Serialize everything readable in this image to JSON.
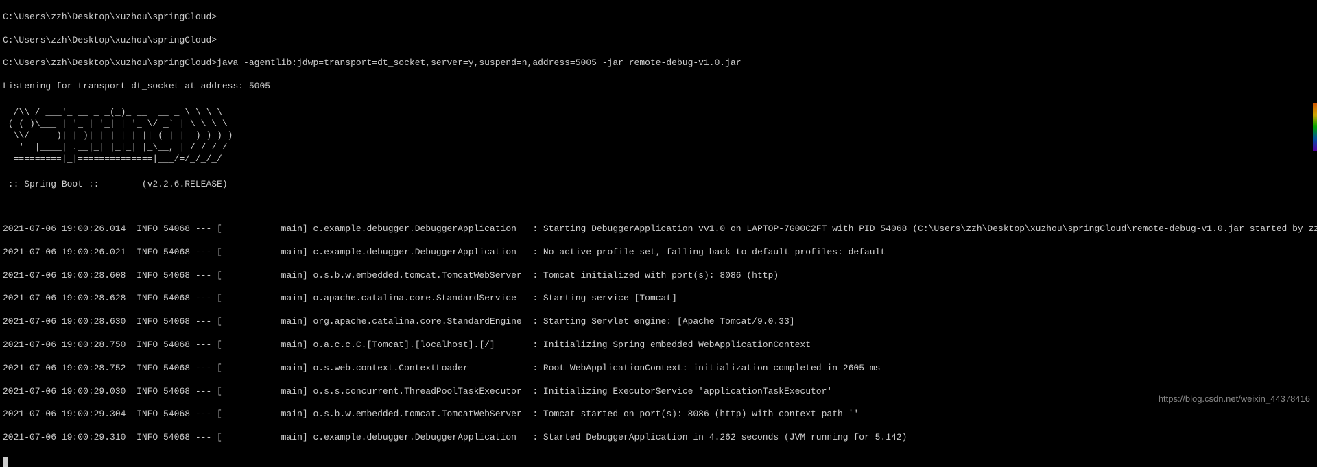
{
  "prompts": [
    "C:\\Users\\zzh\\Desktop\\xuzhou\\springCloud>",
    "C:\\Users\\zzh\\Desktop\\xuzhou\\springCloud>",
    "C:\\Users\\zzh\\Desktop\\xuzhou\\springCloud>java -agentlib:jdwp=transport=dt_socket,server=y,suspend=n,address=5005 -jar remote-debug-v1.0.jar",
    "Listening for transport dt_socket at address: 5005"
  ],
  "banner": "  /\\\\ / ___'_ __ _ _(_)_ __  __ _ \\ \\ \\ \\\n ( ( )\\___ | '_ | '_| | '_ \\/ _` | \\ \\ \\ \\\n  \\\\/  ___)| |_)| | | | | || (_| |  ) ) ) )\n   '  |____| .__|_| |_|_| |_\\__, | / / / /\n  =========|_|==============|___/=/_/_/_/",
  "bootline": " :: Spring Boot ::        (v2.2.6.RELEASE)",
  "logs": [
    "2021-07-06 19:00:26.014  INFO 54068 --- [           main] c.example.debugger.DebuggerApplication   : Starting DebuggerApplication vv1.0 on LAPTOP-7G00C2FT with PID 54068 (C:\\Users\\zzh\\Desktop\\xuzhou\\springCloud\\remote-debug-v1.0.jar started by zzh in C:\\Users\\zzh\\Desktop\\xuzhou\\springCloud)",
    "2021-07-06 19:00:26.021  INFO 54068 --- [           main] c.example.debugger.DebuggerApplication   : No active profile set, falling back to default profiles: default",
    "2021-07-06 19:00:28.608  INFO 54068 --- [           main] o.s.b.w.embedded.tomcat.TomcatWebServer  : Tomcat initialized with port(s): 8086 (http)",
    "2021-07-06 19:00:28.628  INFO 54068 --- [           main] o.apache.catalina.core.StandardService   : Starting service [Tomcat]",
    "2021-07-06 19:00:28.630  INFO 54068 --- [           main] org.apache.catalina.core.StandardEngine  : Starting Servlet engine: [Apache Tomcat/9.0.33]",
    "2021-07-06 19:00:28.750  INFO 54068 --- [           main] o.a.c.c.C.[Tomcat].[localhost].[/]       : Initializing Spring embedded WebApplicationContext",
    "2021-07-06 19:00:28.752  INFO 54068 --- [           main] o.s.web.context.ContextLoader            : Root WebApplicationContext: initialization completed in 2605 ms",
    "2021-07-06 19:00:29.030  INFO 54068 --- [           main] o.s.s.concurrent.ThreadPoolTaskExecutor  : Initializing ExecutorService 'applicationTaskExecutor'",
    "2021-07-06 19:00:29.304  INFO 54068 --- [           main] o.s.b.w.embedded.tomcat.TomcatWebServer  : Tomcat started on port(s): 8086 (http) with context path ''",
    "2021-07-06 19:00:29.310  INFO 54068 --- [           main] c.example.debugger.DebuggerApplication   : Started DebuggerApplication in 4.262 seconds (JVM running for 5.142)"
  ],
  "watermark": "https://blog.csdn.net/weixin_44378416"
}
